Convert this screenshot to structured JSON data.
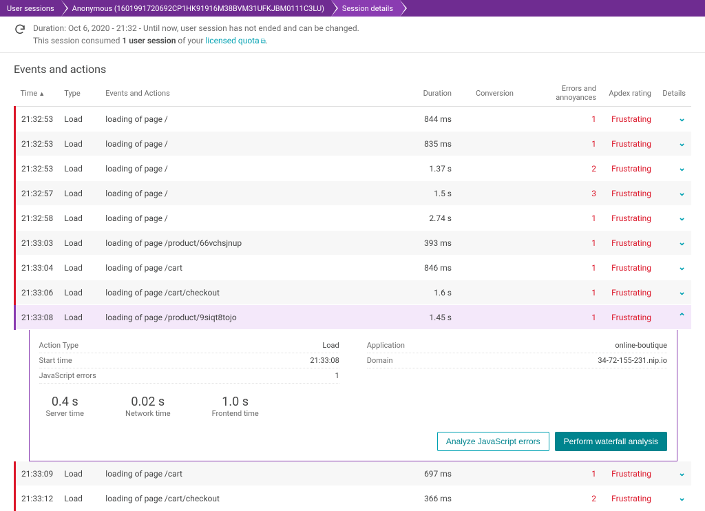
{
  "breadcrumb": {
    "items": [
      "User sessions",
      "Anonymous (1601991720692CP1HK91916M38BVM31UFKJBM0111C3LU)",
      "Session details"
    ]
  },
  "meta": {
    "line1_prefix": "Duration: Oct 6, 2020 - 21:32 - Until now, user session has not ended and can be changed.",
    "line2_a": "This session consumed ",
    "line2_b": "1 user session",
    "line2_c": " of your ",
    "link": "licensed quota"
  },
  "section_title": "Events and actions",
  "columns": {
    "time": "Time",
    "type": "Type",
    "events": "Events and Actions",
    "duration": "Duration",
    "conversion": "Conversion",
    "errors": "Errors and annoyances",
    "apdex": "Apdex rating",
    "details": "Details"
  },
  "rows": [
    {
      "time": "21:32:53",
      "type": "Load",
      "ea": "loading of page /",
      "dur": "844 ms",
      "err": "1",
      "apdex": "Frustrating",
      "selected": false
    },
    {
      "time": "21:32:53",
      "type": "Load",
      "ea": "loading of page /",
      "dur": "835 ms",
      "err": "1",
      "apdex": "Frustrating",
      "selected": false
    },
    {
      "time": "21:32:53",
      "type": "Load",
      "ea": "loading of page /",
      "dur": "1.37 s",
      "err": "2",
      "apdex": "Frustrating",
      "selected": false
    },
    {
      "time": "21:32:57",
      "type": "Load",
      "ea": "loading of page /",
      "dur": "1.5 s",
      "err": "3",
      "apdex": "Frustrating",
      "selected": false
    },
    {
      "time": "21:32:58",
      "type": "Load",
      "ea": "loading of page /",
      "dur": "2.74 s",
      "err": "1",
      "apdex": "Frustrating",
      "selected": false
    },
    {
      "time": "21:33:03",
      "type": "Load",
      "ea": "loading of page /product/66vchsjnup",
      "dur": "393 ms",
      "err": "1",
      "apdex": "Frustrating",
      "selected": false
    },
    {
      "time": "21:33:04",
      "type": "Load",
      "ea": "loading of page /cart",
      "dur": "846 ms",
      "err": "1",
      "apdex": "Frustrating",
      "selected": false
    },
    {
      "time": "21:33:06",
      "type": "Load",
      "ea": "loading of page /cart/checkout",
      "dur": "1.6 s",
      "err": "1",
      "apdex": "Frustrating",
      "selected": false
    },
    {
      "time": "21:33:08",
      "type": "Load",
      "ea": "loading of page /product/9siqt8tojo",
      "dur": "1.45 s",
      "err": "1",
      "apdex": "Frustrating",
      "selected": true
    },
    {
      "time": "21:33:09",
      "type": "Load",
      "ea": "loading of page /cart",
      "dur": "697 ms",
      "err": "1",
      "apdex": "Frustrating",
      "selected": false
    },
    {
      "time": "21:33:12",
      "type": "Load",
      "ea": "loading of page /cart/checkout",
      "dur": "366 ms",
      "err": "2",
      "apdex": "Frustrating",
      "selected": false
    }
  ],
  "detail": {
    "left": {
      "action_type_label": "Action Type",
      "action_type": "Load",
      "start_label": "Start time",
      "start": "21:33:08",
      "jserr_label": "JavaScript errors",
      "jserr": "1"
    },
    "right": {
      "app_label": "Application",
      "app": "online-boutique",
      "domain_label": "Domain",
      "domain": "34-72-155-231.nip.io"
    },
    "timings": {
      "server": {
        "big": "0.4 s",
        "lbl": "Server time"
      },
      "network": {
        "big": "0.02 s",
        "lbl": "Network time"
      },
      "frontend": {
        "big": "1.0 s",
        "lbl": "Frontend time"
      }
    },
    "actions": {
      "analyze": "Analyze JavaScript errors",
      "waterfall": "Perform waterfall analysis"
    }
  }
}
